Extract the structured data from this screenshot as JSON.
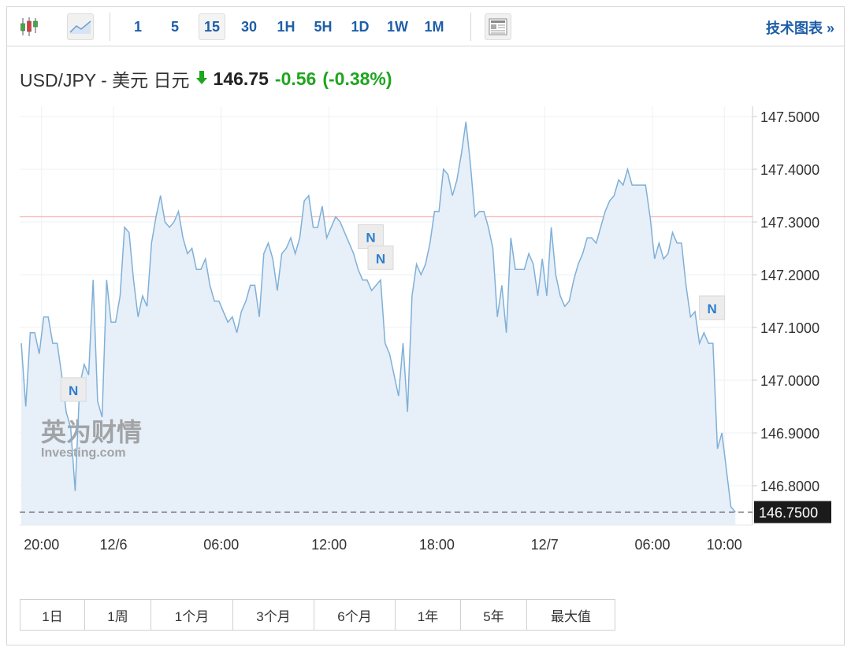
{
  "toolbar": {
    "intervals": [
      "1",
      "5",
      "15",
      "30",
      "1H",
      "5H",
      "1D",
      "1W",
      "1M"
    ],
    "active_interval": "15",
    "tech_chart_label": "技术图表 »"
  },
  "quote": {
    "symbol": "USD/JPY - 美元 日元",
    "price": "146.75",
    "change": "-0.56",
    "change_pct": "(-0.38%)",
    "direction": "down"
  },
  "colors": {
    "accent": "#1d5ea8",
    "up_down_green": "#1fa51f",
    "line": "#7fb0d8",
    "fill": "#e7eff8",
    "ref_line": "#f4a3a3"
  },
  "chart_data": {
    "type": "area",
    "interval_minutes": 15,
    "start_hour": -5.25,
    "ylim": [
      146.715,
      147.53
    ],
    "yticks": [
      "147.5000",
      "147.4000",
      "147.3000",
      "147.2000",
      "147.1000",
      "147.0000",
      "146.9000",
      "146.8000"
    ],
    "ytick_values": [
      147.5,
      147.4,
      147.3,
      147.2,
      147.1,
      147.0,
      146.9,
      146.8
    ],
    "xticks": [
      {
        "label": "20:00",
        "hour": -4
      },
      {
        "label": "12/6",
        "hour": 0
      },
      {
        "label": "06:00",
        "hour": 6
      },
      {
        "label": "12:00",
        "hour": 12
      },
      {
        "label": "18:00",
        "hour": 18
      },
      {
        "label": "12/7",
        "hour": 24
      },
      {
        "label": "06:00",
        "hour": 30
      },
      {
        "label": "10:00",
        "hour": 34
      }
    ],
    "reference_value": 147.31,
    "last_value_label": "146.7500",
    "last_value": 146.75,
    "values": [
      147.07,
      146.95,
      147.09,
      147.09,
      147.05,
      147.12,
      147.12,
      147.07,
      147.07,
      147.01,
      146.94,
      146.91,
      146.79,
      146.99,
      147.03,
      147.01,
      147.19,
      146.96,
      146.93,
      147.19,
      147.11,
      147.11,
      147.16,
      147.29,
      147.28,
      147.19,
      147.12,
      147.16,
      147.14,
      147.26,
      147.31,
      147.35,
      147.3,
      147.29,
      147.3,
      147.32,
      147.27,
      147.24,
      147.25,
      147.21,
      147.21,
      147.23,
      147.18,
      147.15,
      147.15,
      147.13,
      147.11,
      147.12,
      147.09,
      147.13,
      147.15,
      147.18,
      147.18,
      147.12,
      147.24,
      147.26,
      147.23,
      147.17,
      147.24,
      147.25,
      147.27,
      147.24,
      147.27,
      147.34,
      147.35,
      147.29,
      147.29,
      147.33,
      147.27,
      147.29,
      147.31,
      147.3,
      147.28,
      147.26,
      147.24,
      147.21,
      147.19,
      147.19,
      147.17,
      147.18,
      147.19,
      147.07,
      147.05,
      147.01,
      146.97,
      147.07,
      146.94,
      147.16,
      147.22,
      147.2,
      147.22,
      147.26,
      147.32,
      147.32,
      147.4,
      147.39,
      147.35,
      147.38,
      147.43,
      147.49,
      147.41,
      147.31,
      147.32,
      147.32,
      147.29,
      147.25,
      147.12,
      147.18,
      147.09,
      147.27,
      147.21,
      147.21,
      147.21,
      147.24,
      147.22,
      147.16,
      147.23,
      147.16,
      147.29,
      147.2,
      147.16,
      147.14,
      147.15,
      147.19,
      147.22,
      147.24,
      147.27,
      147.27,
      147.26,
      147.29,
      147.32,
      147.34,
      147.35,
      147.38,
      147.37,
      147.4,
      147.37,
      147.37,
      147.37,
      147.37,
      147.31,
      147.23,
      147.26,
      147.23,
      147.24,
      147.28,
      147.26,
      147.26,
      147.18,
      147.12,
      147.13,
      147.07,
      147.09,
      147.07,
      147.07,
      146.87,
      146.9,
      146.83,
      146.76,
      146.75
    ],
    "news_markers": [
      {
        "label": "N",
        "hour": -2.35,
        "value": 146.96
      },
      {
        "label": "N",
        "hour": 14.2,
        "value": 147.25
      },
      {
        "label": "N",
        "hour": 14.75,
        "value": 147.21
      },
      {
        "label": "N",
        "hour": 33.2,
        "value": 147.115
      }
    ]
  },
  "watermark": {
    "cn": "英为财情",
    "en": "Investing.com"
  },
  "periods": [
    "1日",
    "1周",
    "1个月",
    "3个月",
    "6个月",
    "1年",
    "5年",
    "最大值"
  ]
}
